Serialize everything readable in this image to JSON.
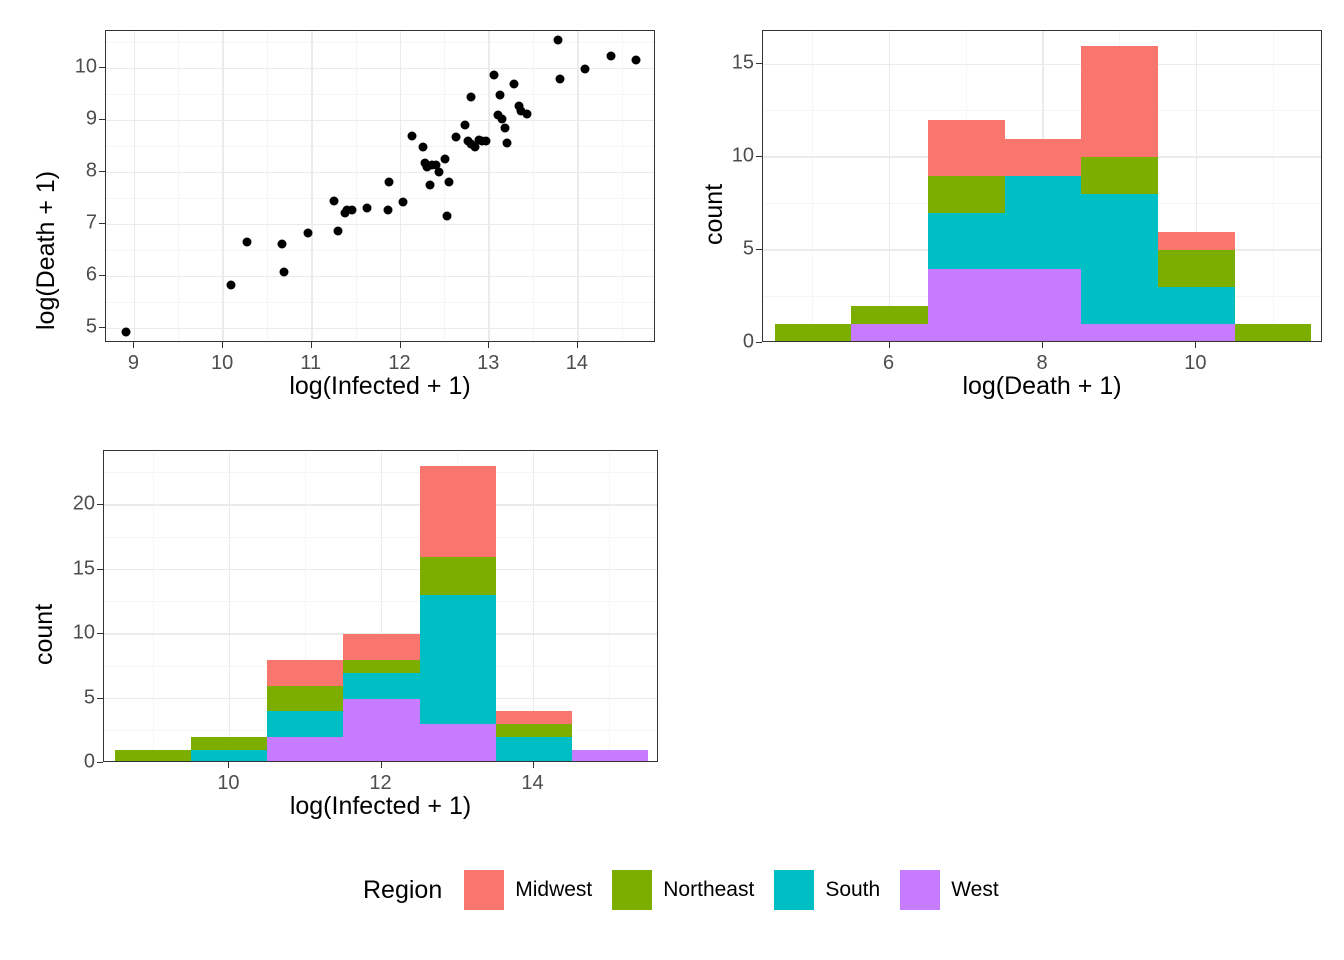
{
  "legend": {
    "title": "Region",
    "items": [
      {
        "label": "Midwest",
        "color": "#F8766D"
      },
      {
        "label": "Northeast",
        "color": "#7CAE00"
      },
      {
        "label": "South",
        "color": "#00BFC4"
      },
      {
        "label": "West",
        "color": "#C77CFF"
      }
    ]
  },
  "palette": {
    "Midwest": "#F8766D",
    "Northeast": "#7CAE00",
    "South": "#00BFC4",
    "West": "#C77CFF",
    "point": "#000000",
    "panel_border": "#333333",
    "grid_major": "#EBEBEB",
    "grid_minor": "#F5F5F5",
    "tick_text": "#4D4D4D",
    "title_text": "#000000"
  },
  "chart_data": [
    {
      "id": "scatter-death-vs-infected",
      "type": "scatter",
      "title": "",
      "xlabel": "log(Infected + 1)",
      "ylabel": "log(Death + 1)",
      "xticks": [
        9,
        10,
        11,
        12,
        13,
        14
      ],
      "yticks": [
        5,
        6,
        7,
        8,
        9,
        10
      ],
      "xlim": [
        8.68,
        14.88
      ],
      "ylim": [
        4.72,
        10.72
      ],
      "grid": true,
      "legend_position": "bottom",
      "points": [
        {
          "x": 8.9,
          "y": 4.93
        },
        {
          "x": 10.09,
          "y": 5.84
        },
        {
          "x": 10.27,
          "y": 6.66
        },
        {
          "x": 10.66,
          "y": 6.63
        },
        {
          "x": 10.69,
          "y": 6.08
        },
        {
          "x": 10.96,
          "y": 6.83
        },
        {
          "x": 11.25,
          "y": 7.46
        },
        {
          "x": 11.3,
          "y": 6.87
        },
        {
          "x": 11.37,
          "y": 7.22
        },
        {
          "x": 11.4,
          "y": 7.28
        },
        {
          "x": 11.45,
          "y": 7.27
        },
        {
          "x": 11.62,
          "y": 7.31
        },
        {
          "x": 11.86,
          "y": 7.27
        },
        {
          "x": 11.87,
          "y": 7.82
        },
        {
          "x": 12.03,
          "y": 7.44
        },
        {
          "x": 12.13,
          "y": 8.7
        },
        {
          "x": 12.25,
          "y": 8.49
        },
        {
          "x": 12.28,
          "y": 8.19
        },
        {
          "x": 12.3,
          "y": 8.1
        },
        {
          "x": 12.33,
          "y": 7.75
        },
        {
          "x": 12.36,
          "y": 8.15
        },
        {
          "x": 12.4,
          "y": 8.14
        },
        {
          "x": 12.43,
          "y": 8.0
        },
        {
          "x": 12.5,
          "y": 8.25
        },
        {
          "x": 12.52,
          "y": 7.16
        },
        {
          "x": 12.55,
          "y": 7.81
        },
        {
          "x": 12.62,
          "y": 8.68
        },
        {
          "x": 12.73,
          "y": 8.92
        },
        {
          "x": 12.76,
          "y": 8.6
        },
        {
          "x": 12.79,
          "y": 9.45
        },
        {
          "x": 12.8,
          "y": 8.55
        },
        {
          "x": 12.84,
          "y": 8.48
        },
        {
          "x": 12.88,
          "y": 8.62
        },
        {
          "x": 12.92,
          "y": 8.6
        },
        {
          "x": 12.96,
          "y": 8.6
        },
        {
          "x": 13.05,
          "y": 9.87
        },
        {
          "x": 13.1,
          "y": 9.1
        },
        {
          "x": 13.12,
          "y": 9.49
        },
        {
          "x": 13.14,
          "y": 9.03
        },
        {
          "x": 13.18,
          "y": 8.86
        },
        {
          "x": 13.2,
          "y": 8.57
        },
        {
          "x": 13.28,
          "y": 9.7
        },
        {
          "x": 13.33,
          "y": 9.28
        },
        {
          "x": 13.36,
          "y": 9.19
        },
        {
          "x": 13.43,
          "y": 9.13
        },
        {
          "x": 13.78,
          "y": 10.55
        },
        {
          "x": 13.8,
          "y": 9.8
        },
        {
          "x": 14.08,
          "y": 9.98
        },
        {
          "x": 14.37,
          "y": 10.24
        },
        {
          "x": 14.66,
          "y": 10.17
        }
      ]
    },
    {
      "id": "histogram-log-death",
      "type": "bar",
      "subtype": "stacked-histogram",
      "title": "",
      "xlabel": "log(Death + 1)",
      "ylabel": "count",
      "xticks": [
        6,
        8,
        10
      ],
      "yticks": [
        0,
        5,
        10,
        15
      ],
      "xlim": [
        4.35,
        11.65
      ],
      "ylim": [
        0,
        16.8
      ],
      "grid": true,
      "binwidth": 1,
      "bins": [
        {
          "left": 4.5,
          "right": 5.5
        },
        {
          "left": 5.5,
          "right": 6.5
        },
        {
          "left": 6.5,
          "right": 7.5
        },
        {
          "left": 7.5,
          "right": 8.5
        },
        {
          "left": 8.5,
          "right": 9.5
        },
        {
          "left": 9.5,
          "right": 10.5
        },
        {
          "left": 10.5,
          "right": 11.5
        }
      ],
      "series": [
        {
          "name": "West",
          "values": [
            0,
            1,
            4,
            4,
            1,
            1,
            0
          ]
        },
        {
          "name": "South",
          "values": [
            0,
            0,
            3,
            5,
            7,
            2,
            0
          ]
        },
        {
          "name": "Northeast",
          "values": [
            1,
            1,
            2,
            0,
            2,
            2,
            1
          ]
        },
        {
          "name": "Midwest",
          "values": [
            0,
            0,
            3,
            2,
            6,
            1,
            0
          ]
        }
      ],
      "totals": [
        1,
        2,
        12,
        11,
        16,
        6,
        1
      ]
    },
    {
      "id": "histogram-log-infected",
      "type": "bar",
      "subtype": "stacked-histogram",
      "title": "",
      "xlabel": "log(Infected + 1)",
      "ylabel": "count",
      "xticks": [
        10,
        12,
        14
      ],
      "yticks": [
        0,
        5,
        10,
        15,
        20
      ],
      "xlim": [
        8.35,
        15.65
      ],
      "ylim": [
        0,
        24.2
      ],
      "grid": true,
      "binwidth": 1,
      "bins": [
        {
          "left": 8.5,
          "right": 9.5
        },
        {
          "left": 9.5,
          "right": 10.5
        },
        {
          "left": 10.5,
          "right": 11.5
        },
        {
          "left": 11.5,
          "right": 12.5
        },
        {
          "left": 12.5,
          "right": 13.5
        },
        {
          "left": 13.5,
          "right": 14.5
        },
        {
          "left": 14.5,
          "right": 15.5
        }
      ],
      "series": [
        {
          "name": "West",
          "values": [
            0,
            0,
            2,
            5,
            3,
            0,
            1
          ]
        },
        {
          "name": "South",
          "values": [
            0,
            1,
            2,
            2,
            10,
            2,
            0
          ]
        },
        {
          "name": "Northeast",
          "values": [
            1,
            1,
            2,
            1,
            3,
            1,
            0
          ]
        },
        {
          "name": "Midwest",
          "values": [
            0,
            0,
            2,
            2,
            7,
            1,
            0
          ]
        }
      ],
      "totals": [
        1,
        2,
        8,
        10,
        23,
        4,
        1
      ]
    }
  ]
}
